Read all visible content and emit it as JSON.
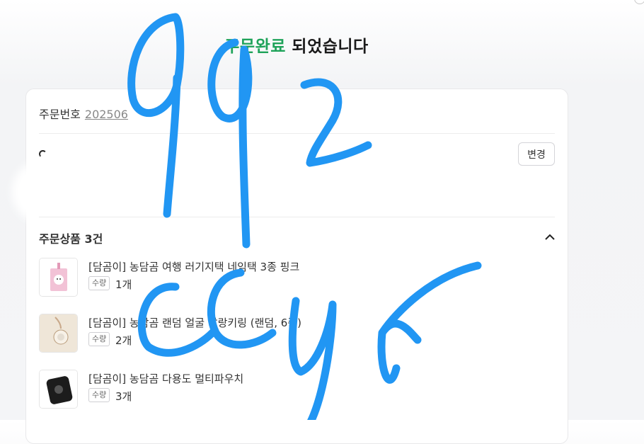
{
  "headline": {
    "accent": "주문완료",
    "rest": " 되었습니다"
  },
  "order": {
    "label": "주문번호",
    "number": "202506"
  },
  "address": {
    "change_label": "변경"
  },
  "items_section": {
    "title": "주문상품 3건"
  },
  "items": [
    {
      "name": "[담곰이] 농담곰 여행 러기지택 네임택 3종 핑크",
      "qty_label": "수량",
      "qty": "1개"
    },
    {
      "name": "[담곰이] 농담곰 랜덤 얼굴 찰랑키링 (랜덤, 6종)",
      "qty_label": "수량",
      "qty": "2개"
    },
    {
      "name": "[담곰이] 농담곰 다용도 멀티파우치",
      "qty_label": "수량",
      "qty": "3개"
    }
  ],
  "colors": {
    "accent": "#1fa35a",
    "scribble": "#2196f3"
  },
  "overlay": {
    "handwriting": "992 CCUr"
  }
}
